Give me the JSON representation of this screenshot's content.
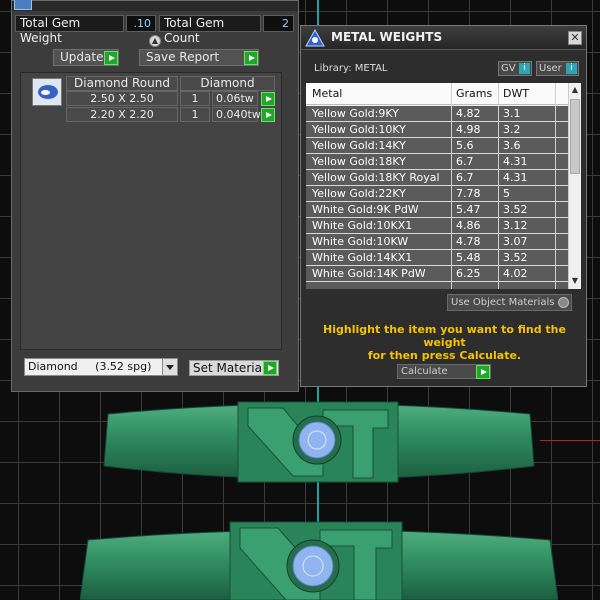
{
  "gem_panel": {
    "total_gem_weight_label": "Total Gem Weight",
    "total_gem_weight_value": ".10",
    "total_gem_count_label": "Total Gem Count",
    "total_gem_count_value": "2",
    "update_label": "Update",
    "save_report_label": "Save Report",
    "table_header_name": "Diamond Round",
    "table_header_type": "Diamond",
    "rows": [
      {
        "size": "2.50 X 2.50",
        "count": "1",
        "weight": "0.06tw"
      },
      {
        "size": "2.20 X 2.20",
        "count": "1",
        "weight": "0.040tw"
      }
    ],
    "material_select_value": "Diamond     (3.52 spg)",
    "set_material_label": "Set Material"
  },
  "metal_panel": {
    "title": "METAL WEIGHTS",
    "library_label": "Library: METAL",
    "gv_label": "GV",
    "user_label": "User",
    "columns": [
      "Metal",
      "Grams",
      "DWT"
    ],
    "rows": [
      {
        "metal": "Yellow Gold:9KY",
        "grams": "4.82",
        "dwt": "3.1"
      },
      {
        "metal": "Yellow Gold:10KY",
        "grams": "4.98",
        "dwt": "3.2"
      },
      {
        "metal": "Yellow Gold:14KY",
        "grams": "5.6",
        "dwt": "3.6"
      },
      {
        "metal": "Yellow Gold:18KY",
        "grams": "6.7",
        "dwt": "4.31"
      },
      {
        "metal": "Yellow Gold:18KY Royal",
        "grams": "6.7",
        "dwt": "4.31"
      },
      {
        "metal": "Yellow Gold:22KY",
        "grams": "7.78",
        "dwt": "5"
      },
      {
        "metal": "White Gold:9K PdW",
        "grams": "5.47",
        "dwt": "3.52"
      },
      {
        "metal": "White Gold:10KX1",
        "grams": "4.86",
        "dwt": "3.12"
      },
      {
        "metal": "White Gold:10KW",
        "grams": "4.78",
        "dwt": "3.07"
      },
      {
        "metal": "White Gold:14KX1",
        "grams": "5.48",
        "dwt": "3.52"
      },
      {
        "metal": "White Gold:14K PdW",
        "grams": "6.25",
        "dwt": "4.02"
      }
    ],
    "use_object_materials_label": "Use Object Materials",
    "hint_line1": "Highlight the item you want to find the weight",
    "hint_line2": "for then press Calculate.",
    "calculate_label": "Calculate"
  },
  "colors": {
    "accent_green": "#1fa62b",
    "hint_yellow": "#f5c400",
    "ring_green": "#2e8a5e",
    "gem_blue": "#8fb4f0"
  }
}
